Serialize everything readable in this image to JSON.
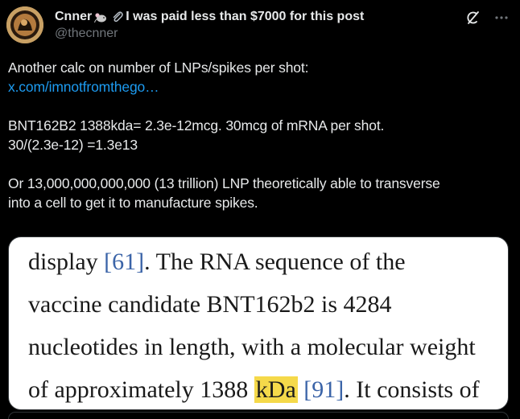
{
  "author": {
    "name_left": "Cnner",
    "name_right": "I was paid less than $7000 for this post",
    "handle": "@thecnner",
    "emojis": [
      "mouse-icon",
      "paperclip-icon"
    ]
  },
  "tweet": {
    "line1": "Another calc on number of LNPs/spikes per shot:",
    "link": "x.com/imnotfromthego…",
    "line3": "BNT162B2 1388kda= 2.3e-12mcg. 30mcg of mRNA per shot.",
    "line4": "30/(2.3e-12) =1.3e13",
    "line5": "Or 13,000,000,000,000 (13 trillion) LNP theoretically able to transverse",
    "line6": "into a cell to get it to manufacture spikes."
  },
  "media": {
    "l1_a": "display ",
    "l1_cite": "[61]",
    "l1_b": ". The RNA sequence of the",
    "l2": "vaccine candidate BNT162b2 is 4284",
    "l3": "nucleotides in length, with a molecular weight",
    "l4_a": "of approximately 1388 ",
    "l4_hl": "kDa",
    "l4_space": " ",
    "l4_cite": "[91]",
    "l4_b": ". It consists of"
  },
  "colors": {
    "link": "#1d9bf0",
    "highlight": "#f5d94a",
    "citation": "#3b64a8"
  }
}
